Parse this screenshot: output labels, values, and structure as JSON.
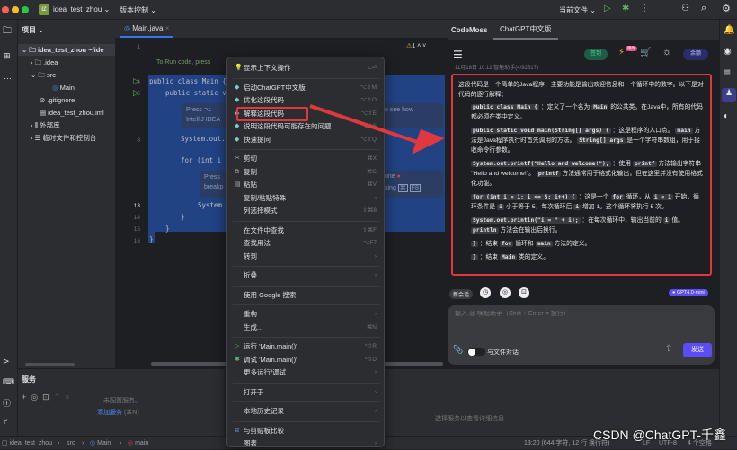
{
  "titlebar": {
    "project_badge": "IZ",
    "project": "idea_test_zhou",
    "vcs": "版本控制",
    "run_config": "当前文件"
  },
  "project_panel": {
    "title": "项目",
    "items": [
      "idea_test_zhou ~/ide",
      "idea",
      "src",
      "Main",
      ".gitignore",
      "idea_test_zhou.iml",
      "外部库",
      "临时文件和控制台"
    ]
  },
  "editor": {
    "tab": "Main.java",
    "warnings": "1",
    "line_numbers": [
      "1",
      "4",
      "5",
      "",
      "",
      "8",
      "",
      "",
      "",
      "",
      "13",
      "14",
      "15",
      "16"
    ],
    "run_hint": "To Run code, press",
    "lines": [
      "public class Main {",
      "public static v",
      "System.out.",
      "for (int i",
      "System.",
      "}",
      "}",
      "}"
    ],
    "hint1": [
      "Press ⌥",
      "IntelliJ IDEA"
    ],
    "hint1_tail": "o see how",
    "hint2": [
      "Press",
      "breakp"
    ],
    "hint2_tail": [
      "one",
      "sing",
      "⌘",
      "F8"
    ]
  },
  "context_menu": {
    "header": {
      "label": "显示上下文操作",
      "shortcut": "⌥⏎"
    },
    "ai_items": [
      {
        "label": "启动ChatGPT中文版",
        "shortcut": "⌥⇧M"
      },
      {
        "label": "优化这段代码",
        "shortcut": "⌥⇧O"
      },
      {
        "label": "解释这段代码",
        "shortcut": "⌥⇧E"
      },
      {
        "label": "说明这段代码可能存在的问题",
        "shortcut": "⌥⇧S"
      },
      {
        "label": "快速提问",
        "shortcut": "⌥⇧Q"
      }
    ],
    "edit_items": [
      {
        "label": "剪切",
        "shortcut": "⌘X"
      },
      {
        "label": "复制",
        "shortcut": "⌘C"
      },
      {
        "label": "粘贴",
        "shortcut": "⌘V"
      },
      {
        "label": "复制/粘贴特殊",
        "shortcut": "›"
      },
      {
        "label": "列选择模式",
        "shortcut": "⇧⌘8"
      }
    ],
    "find_items": [
      {
        "label": "在文件中查找",
        "shortcut": "⇧⌘F"
      },
      {
        "label": "查找用法",
        "shortcut": "⌥F7"
      },
      {
        "label": "转到",
        "shortcut": "›"
      }
    ],
    "fold": {
      "label": "折叠",
      "shortcut": "›"
    },
    "google": {
      "label": "使用 Google 搜索"
    },
    "refactor_items": [
      {
        "label": "重构",
        "shortcut": "›"
      },
      {
        "label": "生成...",
        "shortcut": "⌘N"
      }
    ],
    "run_items": [
      {
        "label": "运行 'Main.main()'",
        "shortcut": "^⇧R"
      },
      {
        "label": "调试 'Main.main()'",
        "shortcut": "^⇧D"
      },
      {
        "label": "更多运行/调试",
        "shortcut": "›"
      }
    ],
    "open_in": {
      "label": "打开于",
      "shortcut": "›"
    },
    "history": {
      "label": "本地历史记录",
      "shortcut": "›"
    },
    "tail_items": [
      {
        "label": "与剪贴板比较",
        "shortcut": ""
      },
      {
        "label": "图表",
        "shortcut": "›"
      }
    ]
  },
  "chat": {
    "tabs": [
      "CodeMoss",
      "ChatGPT中文版"
    ],
    "signin": "签到",
    "badge": "限时",
    "balance": "余额",
    "timestamp": "11月18日 10:12 智能助手(4/92517)",
    "intro": "这段代码是一个简单的Java程序，主要功能是输出欢迎信息和一个循环中的数字。以下是对代码的逐行解释：",
    "items": [
      {
        "code": "public class Main {",
        "text": "：定义了一个名为",
        "c2": "Main",
        "text2": "的公共类。在Java中，所有的代码都必须在类中定义。"
      },
      {
        "code": "public static void main(String[] args) {",
        "text": "：这是程序的入口点。",
        "c2": "main",
        "text2": "方法是Java程序执行时首先调用的方法。",
        "c3": "String[] args",
        "text3": "是一个字符串数组，用于接收命令行参数。"
      },
      {
        "code": "System.out.printf(\"Hello and welcome!\");",
        "text": "：使用",
        "c2": "printf",
        "text2": "方法输出字符串 \"Hello and welcome!\"。",
        "c3": "printf",
        "text3": "方法通常用于格式化输出，但在这里并没有使用格式化功能。"
      },
      {
        "code": "for (int i = 1; i <= 5; i++) {",
        "text": "：这是一个",
        "c2": "for",
        "text2": "循环，从",
        "c3": "i = 1",
        "text3": "开始，循环条件是",
        "c4": "i",
        "text4": "小于等于 5，每次循环后",
        "c5": "i",
        "text5": "增加 1。这个循环将执行 5 次。"
      },
      {
        "code": "System.out.println(\"i = \" + i);",
        "text": "：在每次循环中，输出当前的",
        "c2": "i",
        "text2": "值。",
        "c3": "println",
        "text3": "方法会在输出后换行。"
      },
      {
        "code": "}",
        "text": "：结束",
        "c2": "for",
        "text2": "循环和",
        "c3": "main",
        "text3": "方法的定义。"
      },
      {
        "code": "}",
        "text": "：结束",
        "c2": "Main",
        "text2": "类的定义。"
      }
    ],
    "new_chat": "新会话",
    "model": "GPT4.0-mini",
    "input_placeholder": "输入 @ 唤起助手（Shift + Enter = 换行）",
    "file_chat": "与文件对话",
    "send": "发送"
  },
  "services": {
    "title": "服务",
    "empty": "未配置服务。",
    "add": "添加服务",
    "add_shortcut": "(⌘N)",
    "detail": "选择服务以查看详细信息"
  },
  "statusbar": {
    "crumbs": [
      "idea_test_zhou",
      "src",
      "Main",
      "main"
    ],
    "position": "13:20 (644 字符, 12 行 换行符)",
    "lf": "LF",
    "encoding": "UTF-8",
    "indent": "4 个空格"
  },
  "watermark": "CSDN @ChatGPT-千鑫",
  "colors": {
    "accent": "#5b4cf5",
    "selection": "#214283",
    "highlight": "#e0383e"
  }
}
